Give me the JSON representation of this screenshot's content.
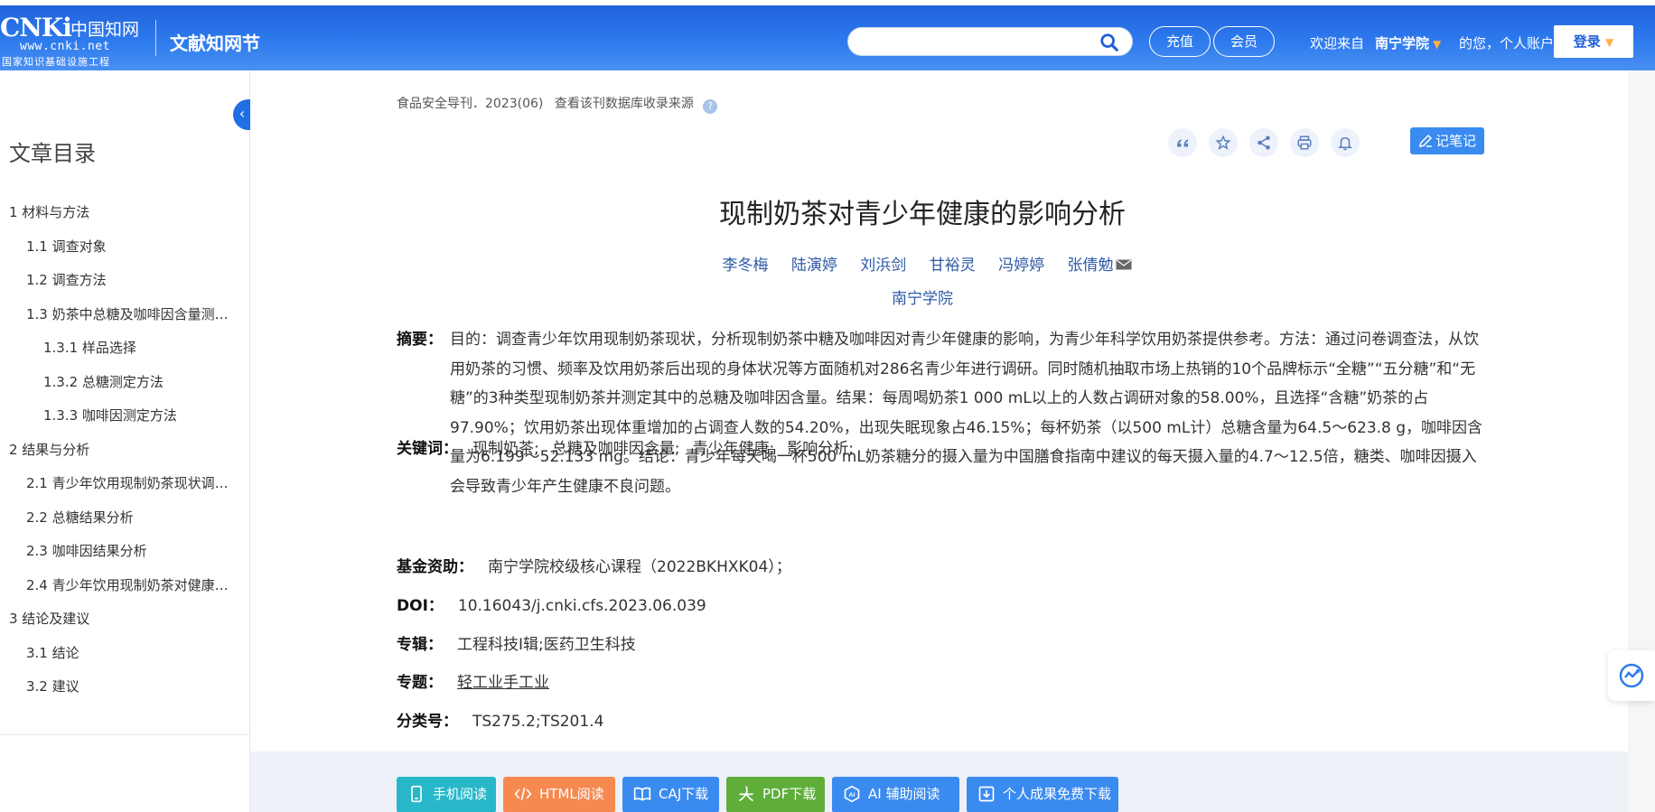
{
  "header": {
    "logo_cnki": "CNKi",
    "logo_cn": "中国知网",
    "logo_url": "www.cnki.net",
    "logo_sub": "国家知识基础设施工程",
    "site_name": "文献知网节",
    "search_placeholder": "",
    "recharge_label": "充值",
    "member_label": "会员",
    "welcome_prefix": "欢迎来自",
    "institution": "南宁学院",
    "welcome_suffix": "的您，个人账户",
    "login_label": "登录"
  },
  "sidebar": {
    "title": "文章目录",
    "items": [
      {
        "level": 1,
        "label": "1 材料与方法"
      },
      {
        "level": 2,
        "label": "1.1 调查对象"
      },
      {
        "level": 2,
        "label": "1.2 调查方法"
      },
      {
        "level": 2,
        "label": "1.3 奶茶中总糖及咖啡因含量测定方法"
      },
      {
        "level": 3,
        "label": "1.3.1 样品选择"
      },
      {
        "level": 3,
        "label": "1.3.2 总糖测定方法"
      },
      {
        "level": 3,
        "label": "1.3.3 咖啡因测定方法"
      },
      {
        "level": 1,
        "label": "2 结果与分析"
      },
      {
        "level": 2,
        "label": "2.1 青少年饮用现制奶茶现状调查结果"
      },
      {
        "level": 2,
        "label": "2.2 总糖结果分析"
      },
      {
        "level": 2,
        "label": "2.3 咖啡因结果分析"
      },
      {
        "level": 2,
        "label": "2.4 青少年饮用现制奶茶对健康的影响"
      },
      {
        "level": 1,
        "label": "3 结论及建议"
      },
      {
        "level": 2,
        "label": "3.1 结论"
      },
      {
        "level": 2,
        "label": "3.2 建议"
      }
    ]
  },
  "article": {
    "source": "食品安全导刊．2023(06)",
    "source_link": "查看该刊数据库收录来源",
    "help_mark": "?",
    "note_label": "记笔记",
    "title": "现制奶茶对青少年健康的影响分析",
    "authors": [
      "李冬梅",
      "陆演婷",
      "刘浜剑",
      "甘裕灵",
      "冯婷婷",
      "张倩勉"
    ],
    "organization": "南宁学院",
    "abstract_label": "摘要：",
    "abstract_text": "目的：调查青少年饮用现制奶茶现状，分析现制奶茶中糖及咖啡因对青少年健康的影响，为青少年科学饮用奶茶提供参考。方法：通过问卷调查法，从饮用奶茶的习惯、频率及饮用奶茶后出现的身体状况等方面随机对286名青少年进行调研。同时随机抽取市场上热销的10个品牌标示“全糖”“五分糖”和“无糖”的3种类型现制奶茶并测定其中的总糖及咖啡因含量。结果：每周喝奶茶1 000 mL以上的人数占调研对象的58.00%，且选择“含糖”奶茶的占97.90%；饮用奶茶出现体重增加的占调查人数的54.20%，出现失眠现象占46.15%；每杯奶茶（以500 mL计）总糖含量为64.5～623.8 g，咖啡因含量为6.199～52.133 mg。结论：青少年每天喝一杯500 mL奶茶糖分的摄入量为中国膳食指南中建议的每天摄入量的4.7～12.5倍，糖类、咖啡因摄入会导致青少年产生健康不良问题。",
    "keywords_label": "关键词：",
    "keywords": [
      "现制奶茶;",
      "总糖及咖啡因含量;",
      "青少年健康;",
      "影响分析;"
    ],
    "fund_label": "基金资助：",
    "fund": "南宁学院校级核心课程（2022BKHXK04）；",
    "doi_label": "DOI：",
    "doi": "10.16043/j.cnki.cfs.2023.06.039",
    "album_label": "专辑：",
    "album": "工程科技Ⅰ辑;医药卫生科技",
    "topic_label": "专题：",
    "topic": "轻工业手工业",
    "class_label": "分类号：",
    "class_no": "TS275.2;TS201.4"
  },
  "downloads": [
    {
      "label": "手机阅读",
      "color": "#27b7c9",
      "icon": "phone-icon"
    },
    {
      "label": "HTML阅读",
      "color": "#f5894f",
      "icon": "code-icon"
    },
    {
      "label": "CAJ下载",
      "color": "#3a8bf0",
      "icon": "book-icon"
    },
    {
      "label": "PDF下载",
      "color": "#5fae3a",
      "icon": "pdf-icon"
    },
    {
      "label": "AI 辅助阅读",
      "color": "#3a8bf0",
      "icon": "ai-icon"
    },
    {
      "label": "个人成果免费下载",
      "color": "#3a8bf0",
      "icon": "download-icon"
    }
  ]
}
